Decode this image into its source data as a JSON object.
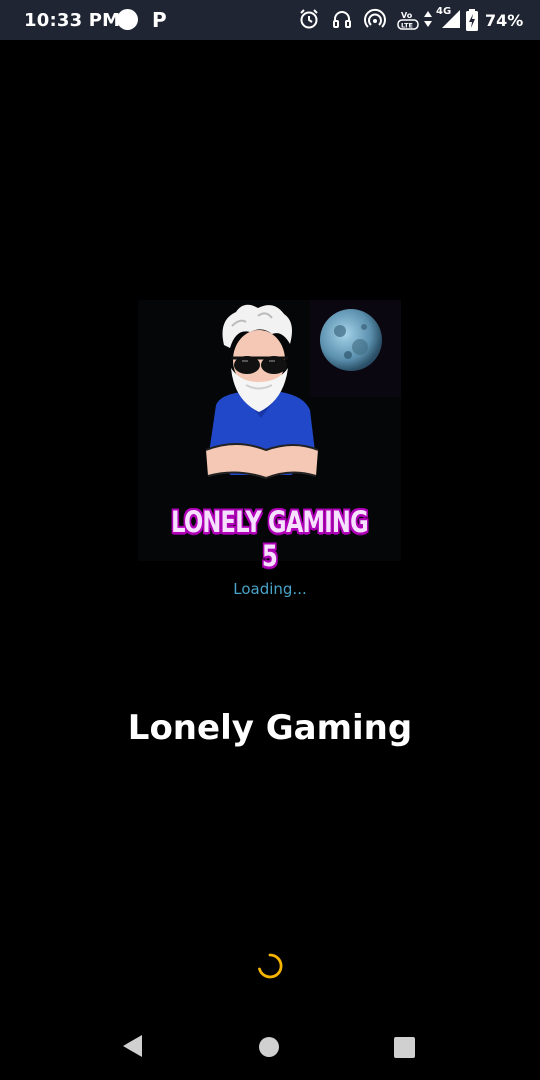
{
  "status_bar": {
    "time": "10:33 PM",
    "network_indicator": "P",
    "signal_label": "4G",
    "volte_label": "Vo LTE",
    "battery": "74%",
    "icons": [
      "alarm-icon",
      "headphones-icon",
      "hotspot-icon",
      "volte-icon",
      "data-arrows-icon",
      "signal-icon",
      "battery-charging-icon"
    ]
  },
  "logo": {
    "caption": "LONELY GAMING 5",
    "icon": "bearded-man-moon-logo"
  },
  "loading_text": "Loading...",
  "app_title": "Lonely Gaming",
  "spinner": {
    "color": "#f5b400"
  },
  "nav_bar": {
    "buttons": [
      "back",
      "home",
      "recents"
    ]
  },
  "colors": {
    "background": "#000000",
    "status_bar": "#1f2533",
    "loading_text": "#4aa3c8",
    "logo_caption": "#b000b8"
  }
}
